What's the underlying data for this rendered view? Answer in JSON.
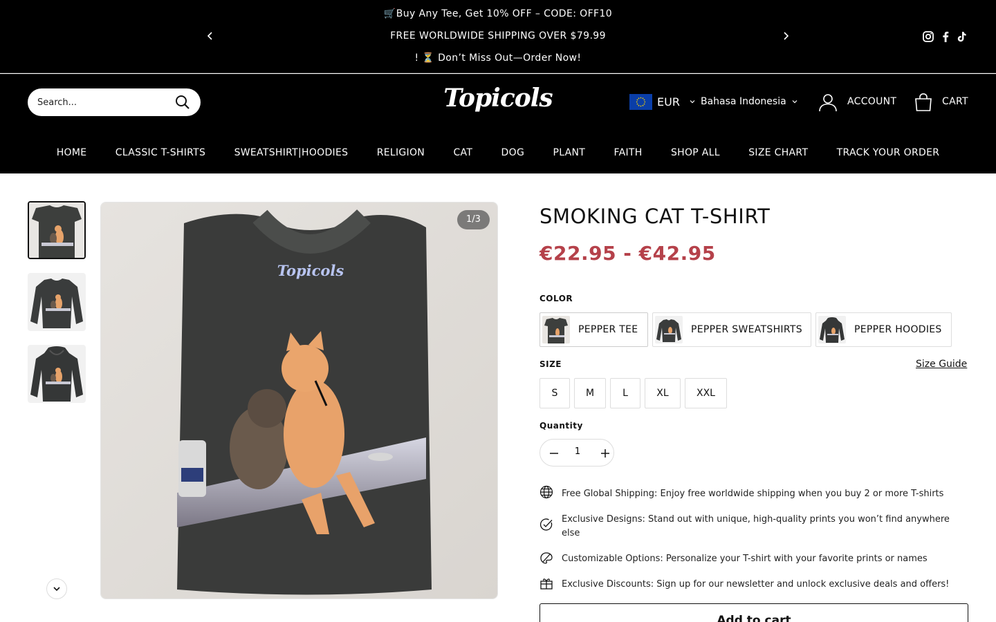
{
  "announcement": {
    "line1": "🛒Buy Any Tee, Get 10% OFF – CODE: OFF10",
    "line2": "FREE WORLDWIDE SHIPPING OVER $79.99",
    "line3": "! ⏳ Don’t Miss Out—Order Now!",
    "prev_icon": "chevron-left-icon",
    "next_icon": "chevron-right-icon",
    "social_icons": [
      "instagram-icon",
      "facebook-icon",
      "tiktok-icon"
    ]
  },
  "header": {
    "search_placeholder": "Search...",
    "logo": "Topicols",
    "currency": "EUR",
    "language": "Bahasa Indonesia",
    "account_label": "ACCOUNT",
    "cart_label": "CART"
  },
  "nav": [
    "HOME",
    "CLASSIC T-SHIRTS",
    "SWEATSHIRT|HOODIES",
    "RELIGION",
    "CAT",
    "DOG",
    "PLANT",
    "FAITH",
    "SHOP ALL",
    "SIZE CHART",
    "TRACK YOUR ORDER"
  ],
  "gallery": {
    "counter": "1/3",
    "shirt_logo": "Topicols"
  },
  "product": {
    "title": "SMOKING CAT T-SHIRT",
    "price": "€22.95 - €42.95",
    "price_color": "#b5414a",
    "color_label": "COLOR",
    "colors": [
      "PEPPER TEE",
      "PEPPER SWEATSHIRTS",
      "PEPPER HOODIES"
    ],
    "size_label": "SIZE",
    "size_guide": "Size Guide",
    "sizes": [
      "S",
      "M",
      "L",
      "XL",
      "XXL"
    ],
    "quantity_label": "Quantity",
    "quantity": "1",
    "features": [
      {
        "icon": "globe-icon",
        "text": "Free Global Shipping: Enjoy free worldwide shipping when you buy 2 or more T-shirts"
      },
      {
        "icon": "badge-check-icon",
        "text": "Exclusive Designs: Stand out with unique, high-quality prints you won’t find anywhere else"
      },
      {
        "icon": "palette-icon",
        "text": "Customizable Options: Personalize your T-shirt with your favorite prints or names"
      },
      {
        "icon": "gift-icon",
        "text": "Exclusive Discounts: Sign up for our newsletter and unlock exclusive deals and offers!"
      }
    ],
    "add_to_cart": "Add to cart"
  }
}
